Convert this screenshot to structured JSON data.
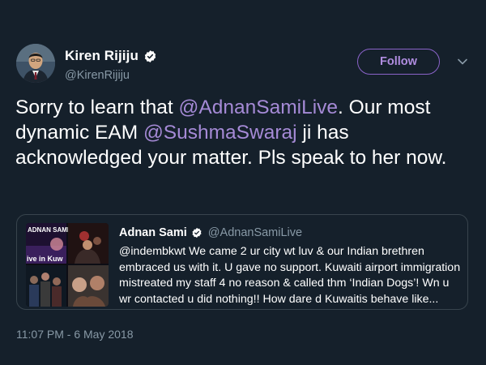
{
  "author": {
    "name": "Kiren Rijiju",
    "handle": "@KirenRijiju",
    "verified": true
  },
  "follow_label": "Follow",
  "body": {
    "t1": "Sorry to learn that ",
    "m1": "@AdnanSamiLive",
    "t2": ". Our most dynamic EAM ",
    "m2": "@SushmaSwaraj",
    "t3": " ji has acknowledged your matter. Pls speak to her now."
  },
  "quoted": {
    "name": "Adnan Sami",
    "handle": "@AdnanSamiLive",
    "verified": true,
    "text": "@indembkwt We came 2 ur city wt luv & our Indian brethren embraced us with it. U gave no support. Kuwaiti airport immigration mistreated my staff 4 no reason & called thm ‘Indian Dogs’! Wn u wr contacted u did nothing!! How dare d Kuwaitis behave like...",
    "media_caption_top": "ADNAN SAMI",
    "media_caption_bottom": "ive in Kuw"
  },
  "timestamp": "11:07 PM - 6 May 2018",
  "colors": {
    "background": "#15202b",
    "mention": "#a58ad6",
    "follow_border": "#8a63c9",
    "muted": "#8899a6",
    "border": "#38444d"
  },
  "icons": [
    "verified-badge-icon",
    "chevron-down-icon"
  ]
}
